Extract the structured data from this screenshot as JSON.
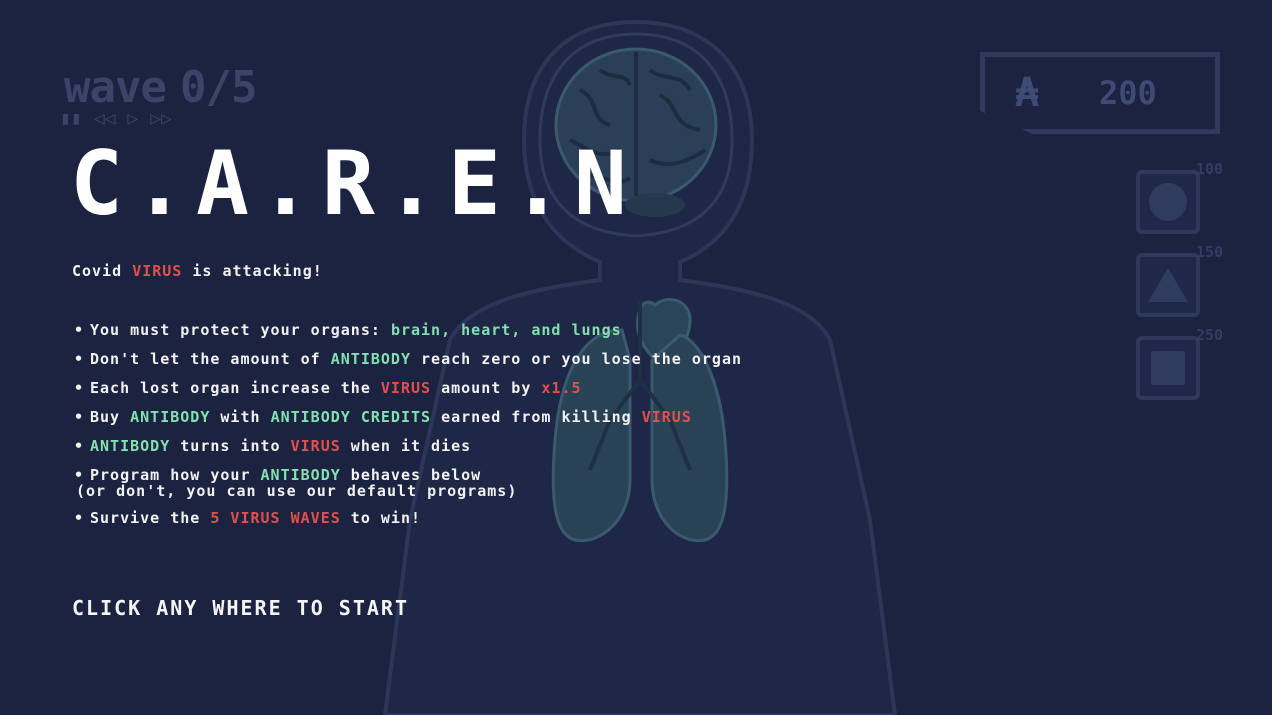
{
  "hud": {
    "wave_label": "wave",
    "wave_value": "0/5",
    "controls": [
      "▮▮",
      "◁◁",
      "▷",
      "▷▷"
    ],
    "credits_symbol": "₳",
    "credits_value": "200"
  },
  "shop": [
    {
      "icon": "circle-antibody-icon",
      "price": "100"
    },
    {
      "icon": "triangle-antibody-icon",
      "price": "150"
    },
    {
      "icon": "square-antibody-icon",
      "price": "250"
    }
  ],
  "title": "C.A.R.E.N",
  "intro": {
    "a": "Covid ",
    "b": "VIRUS",
    "c": " is attacking!"
  },
  "rules": [
    {
      "a": "You must protect your organs: ",
      "b": "brain, heart, and lungs"
    },
    {
      "a": "Don't let the amount of ",
      "b": "ANTIBODY",
      "c": " reach zero or you lose the organ"
    },
    {
      "a": "Each lost organ increase the ",
      "b": "VIRUS",
      "c": " amount by ",
      "d": "x1.5"
    },
    {
      "a": "Buy ",
      "b": "ANTIBODY",
      "c": " with ",
      "d": "ANTIBODY CREDITS",
      "e": " earned from killing ",
      "f": "VIRUS"
    },
    {
      "a": "ANTIBODY",
      "b": " turns into ",
      "c": "VIRUS",
      "d": " when it dies"
    },
    {
      "a": "Program how your ",
      "b": "ANTIBODY",
      "c": " behaves below",
      "d": "(or don't, you can use our default programs)"
    },
    {
      "a": "Survive the ",
      "b": "5 VIRUS WAVES",
      "c": " to win!"
    }
  ],
  "start_label": "CLICK ANY WHERE TO START",
  "colors": {
    "background": "#1c2340",
    "virus": "#e2504c",
    "antibody": "#83e0b0"
  }
}
